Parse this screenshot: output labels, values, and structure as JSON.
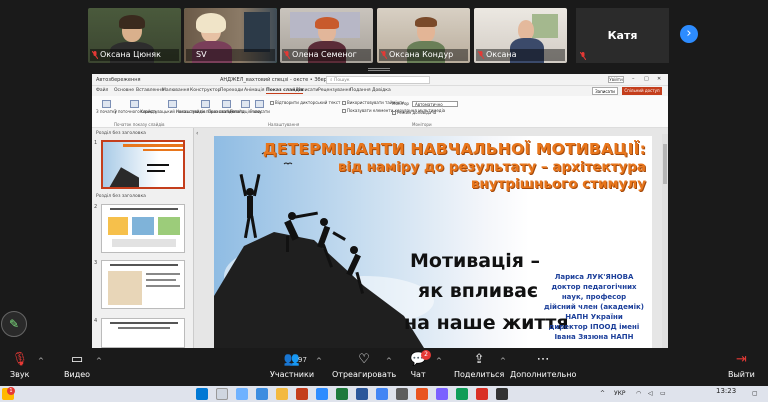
{
  "participants": [
    {
      "name": "Оксана Цюняк"
    },
    {
      "name": "SV"
    },
    {
      "name": "Олена Семеног"
    },
    {
      "name": "Оксана Кондур"
    },
    {
      "name": "Оксана"
    },
    {
      "name": "Катя"
    }
  ],
  "next_page_icon": "chevron-right-icon",
  "ppt": {
    "title_bar": {
      "file_label": "Автозбереження",
      "doc_title": "АНДЖЕЛ_вахтовий спецзі - оксте • Збережено у цей ПК",
      "search_placeholder": "Пошук",
      "login_label": "Увійти"
    },
    "tabs": [
      "Файл",
      "Основне",
      "Вставлення",
      "Малювання",
      "Конструктор",
      "Переходи",
      "Анімація",
      "Показ слайдів",
      "Записати",
      "Рецензування",
      "Подання",
      "Довідка"
    ],
    "active_tab": "Показ слайдів",
    "record_label": "Записати",
    "share_label": "Спільний доступ",
    "ribbon_buttons": [
      "З початку",
      "З поточного слайда",
      "Користувацький показ слайдів",
      "Налаштувати показ слайдів",
      "Приховати слайд",
      "Репетиція часу",
      "Записати"
    ],
    "ribbon_options": [
      "Відтворити дикторський текст",
      "Використовувати таймінги",
      "Показувати елементи керування мультимедіа",
      "Монітор",
      "Режим доповідача"
    ],
    "monitor_value": "Автоматично",
    "ribbon_groups": [
      "Початок показу слайдів",
      "Налаштування",
      "Монітори"
    ],
    "sections": [
      "Розділ без заголовка",
      "Розділ без заголовка"
    ],
    "thumbnails": [
      1,
      2,
      3,
      4
    ]
  },
  "slide": {
    "title_line1": "ДЕТЕРМІНАНТИ НАВЧАЛЬНОЇ МОТИВАЦІЇ:",
    "title_line2": "від наміру до результату – архітектура",
    "title_line3": "внутрішнього стимулу",
    "motivation_line1": "Мотивація –",
    "motivation_line2": "як впливає",
    "motivation_line3": "на наше життя",
    "author": [
      "Лариса ЛУК'ЯНОВА",
      "доктор педагогічних",
      "наук, професор",
      "дійсний член (академік)",
      "НАПН України",
      "директор ІПООД імені",
      "Івана Зязюна НАПН"
    ]
  },
  "toolbar": {
    "sound": "Звук",
    "video": "Видео",
    "participants": "Участники",
    "participants_count": "97",
    "react": "Отреагировать",
    "chat": "Чат",
    "chat_badge": "2",
    "share": "Поделиться",
    "more": "Дополнительно",
    "leave": "Выйти"
  },
  "taskbar": {
    "badge": "1",
    "lang": "УКР",
    "time": "13:23"
  },
  "colors": {
    "zoom_blue": "#2d8cff",
    "active_speaker": "#22c55e",
    "ppt_accent": "#c43e1c",
    "slide_title": "#e8761c",
    "author_text": "#1c3f9a"
  }
}
